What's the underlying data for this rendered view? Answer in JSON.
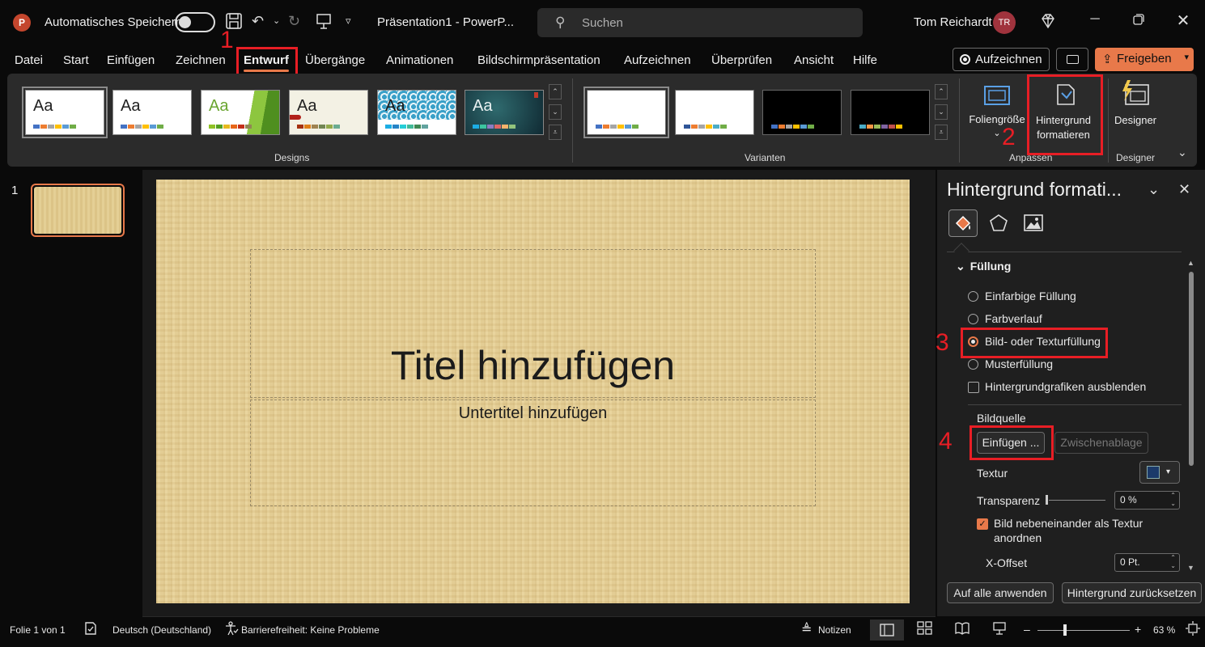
{
  "titlebar": {
    "logo": "P",
    "autosave_label": "Automatisches Speichern",
    "doc_title": "Präsentation1  -  PowerP...",
    "search_placeholder": "Suchen",
    "user_name": "Tom Reichardt",
    "user_initials": "TR",
    "icons": [
      "save-icon",
      "undo-icon",
      "redo-icon",
      "present-icon",
      "customize-icon",
      "search-icon",
      "diamond-icon",
      "minimize-icon",
      "restore-icon",
      "close-icon"
    ]
  },
  "menu": {
    "tabs": [
      "Datei",
      "Start",
      "Einfügen",
      "Zeichnen",
      "Entwurf",
      "Übergänge",
      "Animationen",
      "Bildschirmpräsentation",
      "Aufzeichnen",
      "Überprüfen",
      "Ansicht",
      "Hilfe"
    ],
    "active_tab": "Entwurf",
    "record_label": "Aufzeichnen",
    "share_label": "Freigeben",
    "share_color": "#e8794a"
  },
  "annotations": [
    "1",
    "2",
    "3",
    "4"
  ],
  "annotation_color": "#e81e25",
  "ribbon": {
    "designs_label": "Designs",
    "variants_label": "Varianten",
    "customize_label": "Anpassen",
    "designer_group_label": "Designer",
    "theme_glyph": "Aa",
    "slide_size_label": "Foliengröße",
    "format_bg_label_1": "Hintergrund",
    "format_bg_label_2": "formatieren",
    "designer_label": "Designer"
  },
  "slide_panel": {
    "slide_number": "1"
  },
  "slide": {
    "title_placeholder": "Titel hinzufügen",
    "subtitle_placeholder": "Untertitel hinzufügen"
  },
  "format_pane": {
    "title": "Hintergrund formati...",
    "section": "Füllung",
    "fill_options": [
      "Einfarbige Füllung",
      "Farbverlauf",
      "Bild- oder Texturfüllung",
      "Musterfüllung"
    ],
    "selected_fill": "Bild- oder Texturfüllung",
    "hide_bg_graphics": "Hintergrundgrafiken ausblenden",
    "image_source_label": "Bildquelle",
    "insert_button": "Einfügen ...",
    "clipboard_button": "Zwischenablage",
    "texture_label": "Textur",
    "transparency_label": "Transparenz",
    "transparency_value": "0 %",
    "tile_label_1": "Bild nebeneinander als Textur",
    "tile_label_2": "anordnen",
    "tile_checked": true,
    "x_offset_label": "X-Offset",
    "x_offset_value": "0 Pt.",
    "apply_all_button": "Auf alle anwenden",
    "reset_button": "Hintergrund zurücksetzen"
  },
  "statusbar": {
    "slide_info": "Folie 1 von 1",
    "language": "Deutsch (Deutschland)",
    "accessibility": "Barrierefreiheit: Keine Probleme",
    "notes": "Notizen",
    "zoom": "63 %"
  }
}
